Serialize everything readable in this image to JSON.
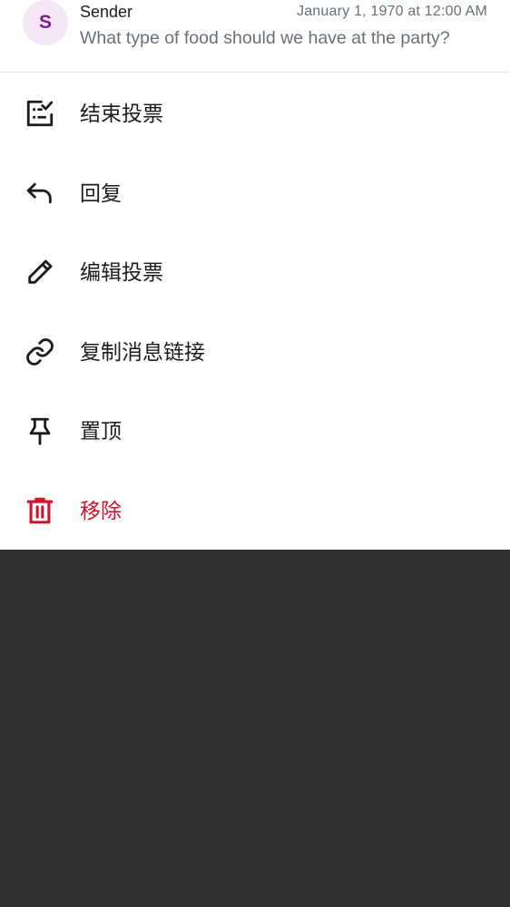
{
  "message": {
    "avatar_letter": "S",
    "sender": "Sender",
    "timestamp": "January 1, 1970 at 12:00 AM",
    "preview": "What type of food should we have at the party?"
  },
  "menu": {
    "items": [
      {
        "label": "结束投票",
        "icon": "end-poll-icon"
      },
      {
        "label": "回复",
        "icon": "reply-icon"
      },
      {
        "label": "编辑投票",
        "icon": "edit-icon"
      },
      {
        "label": "复制消息链接",
        "icon": "link-icon"
      },
      {
        "label": "置顶",
        "icon": "pin-icon"
      },
      {
        "label": "移除",
        "icon": "trash-icon"
      }
    ]
  },
  "colors": {
    "danger": "#d0142c",
    "avatar_bg": "#f4e6f7",
    "avatar_fg": "#7b1f8f",
    "scrim": "#2f2f2f"
  }
}
